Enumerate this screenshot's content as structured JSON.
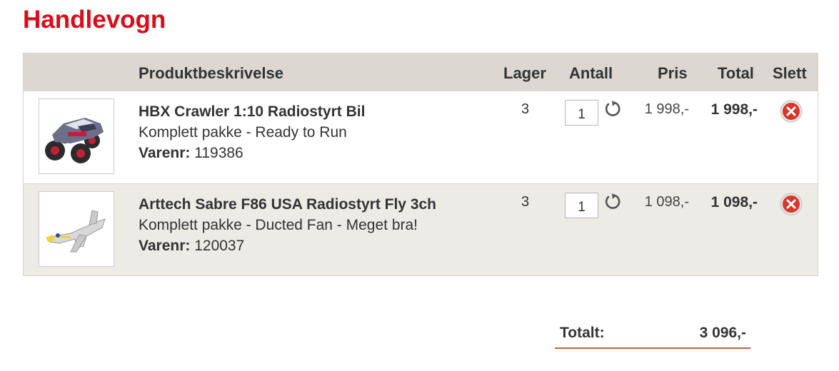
{
  "page": {
    "title": "Handlevogn"
  },
  "table": {
    "headers": {
      "description": "Produktbeskrivelse",
      "stock": "Lager",
      "quantity": "Antall",
      "price": "Pris",
      "total": "Total",
      "delete": "Slett"
    },
    "items": [
      {
        "name": "HBX Crawler 1:10 Radiostyrt Bil",
        "subtitle": "Komplett pakke - Ready to Run",
        "sku_label": "Varenr:",
        "sku": "119386",
        "stock": "3",
        "quantity": "1",
        "price": "1 998,-",
        "total": "1 998,-",
        "image_icon": "rc-crawler-car-icon"
      },
      {
        "name": "Arttech Sabre F86 USA Radiostyrt Fly 3ch",
        "subtitle": "Komplett pakke - Ducted Fan - Meget bra!",
        "sku_label": "Varenr:",
        "sku": "120037",
        "stock": "3",
        "quantity": "1",
        "price": "1 098,-",
        "total": "1 098,-",
        "image_icon": "rc-jet-plane-icon"
      }
    ]
  },
  "summary": {
    "label": "Totalt:",
    "value": "3 096,-"
  },
  "colors": {
    "title": "#d90b1c",
    "header_bg": "#dcd8d1",
    "alt_row_bg": "#ecebe6",
    "summary_line": "#c3603a",
    "delete": "#d9362a"
  }
}
